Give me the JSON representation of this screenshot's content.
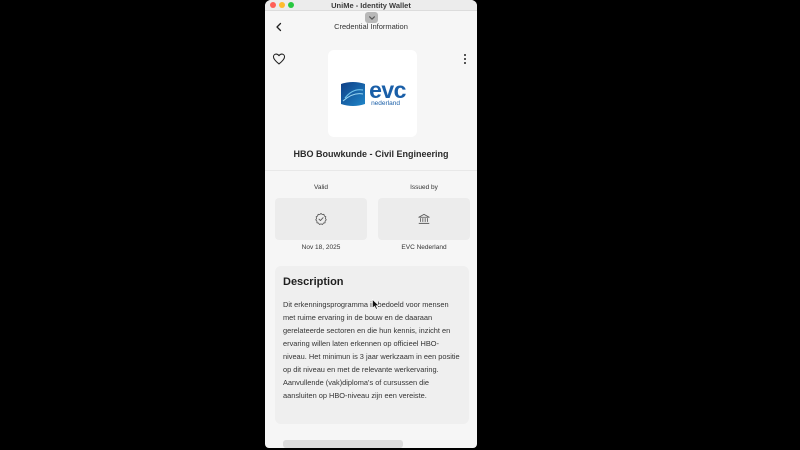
{
  "window": {
    "title": "UniMe - Identity Wallet"
  },
  "nav": {
    "title": "Credential Information"
  },
  "credential": {
    "logo_main": "evc",
    "logo_sub": "nederland",
    "name": "HBO Bouwkunde - Civil Engineering",
    "valid_label": "Valid",
    "valid_value": "Nov 18, 2025",
    "issued_label": "Issued by",
    "issued_value": "EVC Nederland"
  },
  "description": {
    "title": "Description",
    "body": "Dit erkenningsprogramma is bedoeld voor mensen met ruime ervaring in de bouw en de daaraan gerelateerde sectoren en die hun kennis, inzicht en ervaring willen laten erkennen op officieel HBO-niveau. Het minimun is 3 jaar werkzaam in een positie op dit niveau en met de relevante werkervaring. Aanvullende (vak)diploma's of cursussen die aansluiten op HBO-niveau zijn een vereiste."
  },
  "colors": {
    "brand": "#1a5fa8",
    "background": "#f6f6f6"
  },
  "icons": {
    "back": "chevron-left-icon",
    "favorite": "heart-icon",
    "more": "more-vertical-icon",
    "valid": "verified-badge-icon",
    "issuer": "bank-building-icon",
    "pull": "chevron-down-icon"
  }
}
